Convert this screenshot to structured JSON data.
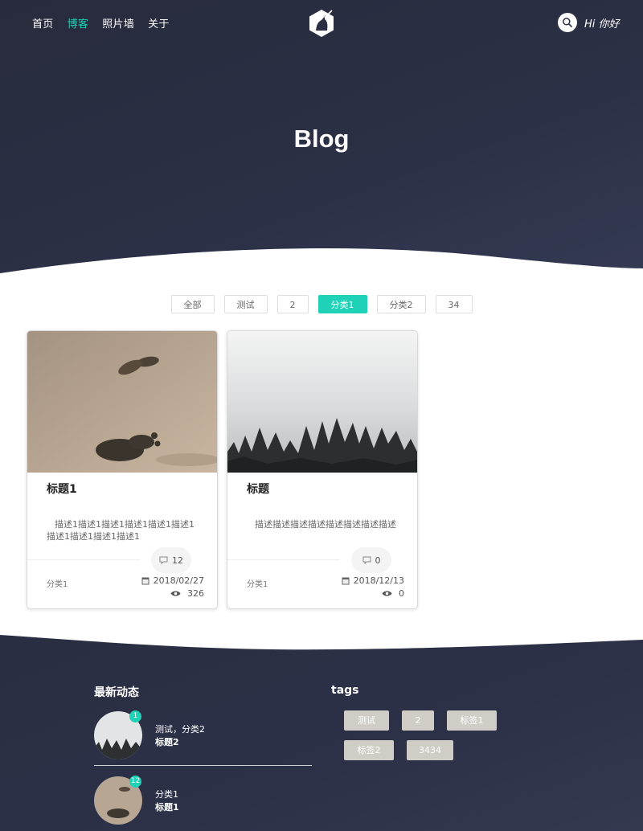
{
  "nav": {
    "items": [
      "首页",
      "博客",
      "照片墙",
      "关于"
    ],
    "active": 1
  },
  "header": {
    "greeting": "Hi 你好",
    "search_icon": "search-icon",
    "logo_icon": "unicorn-logo"
  },
  "hero": {
    "title": "Blog"
  },
  "filters": {
    "items": [
      "全部",
      "测试",
      "2",
      "分类1",
      "分类2",
      "34"
    ],
    "active": 3
  },
  "cards": [
    {
      "title": "标题1",
      "description": "描述1描述1描述1描述1描述1描述1描述1描述1描述1描述1",
      "comments": "12",
      "category": "分类1",
      "date": "2018/02/27",
      "views": "326"
    },
    {
      "title": "标题",
      "description": "描述描述描述描述描述描述描述描述",
      "comments": "0",
      "category": "分类1",
      "date": "2018/12/13",
      "views": "0"
    }
  ],
  "footer": {
    "activity_title": "最新动态",
    "activities": [
      {
        "badge": "1",
        "meta": "测试，分类2",
        "title": "标题2"
      },
      {
        "badge": "12",
        "meta": "分类1",
        "title": "标题1"
      }
    ],
    "tags_title": "tags",
    "tags": [
      "测试",
      "2",
      "标签1",
      "标签2",
      "3434"
    ]
  },
  "colors": {
    "accent": "#1fd1b7",
    "dark": "#2a2e42",
    "tag_bg": "#cfcdc6"
  }
}
